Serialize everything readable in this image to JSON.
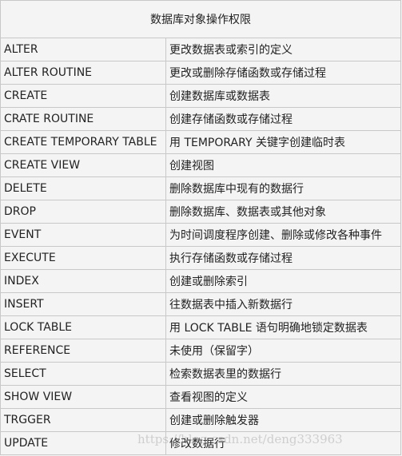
{
  "table": {
    "title": "数据库对象操作权限",
    "rows": [
      {
        "privilege": "ALTER",
        "description": "更改数据表或索引的定义"
      },
      {
        "privilege": "ALTER ROUTINE",
        "description": "更改或删除存储函数或存储过程"
      },
      {
        "privilege": "CREATE",
        "description": "创建数据库或数据表"
      },
      {
        "privilege": "CRATE ROUTINE",
        "description": "创建存储函数或存储过程"
      },
      {
        "privilege": "CREATE TEMPORARY TABLE",
        "description": "用 TEMPORARY 关键字创建临时表"
      },
      {
        "privilege": "CREATE VIEW",
        "description": "创建视图"
      },
      {
        "privilege": "DELETE",
        "description": "删除数据库中现有的数据行"
      },
      {
        "privilege": "DROP",
        "description": "删除数据库、数据表或其他对象"
      },
      {
        "privilege": "EVENT",
        "description": "为时间调度程序创建、删除或修改各种事件"
      },
      {
        "privilege": "EXECUTE",
        "description": "执行存储函数或存储过程"
      },
      {
        "privilege": "INDEX",
        "description": "创建或删除索引"
      },
      {
        "privilege": "INSERT",
        "description": "往数据表中插入新数据行"
      },
      {
        "privilege": "LOCK TABLE",
        "description": "用 LOCK TABLE 语句明确地锁定数据表"
      },
      {
        "privilege": "REFERENCE",
        "description": "未使用（保留字）"
      },
      {
        "privilege": "SELECT",
        "description": "检索数据表里的数据行"
      },
      {
        "privilege": "SHOW VIEW",
        "description": "查看视图的定义"
      },
      {
        "privilege": "TRGGER",
        "description": "创建或删除触发器"
      },
      {
        "privilege": "UPDATE",
        "description": "修改数据行"
      }
    ]
  },
  "watermark": "https://blog.csdn.net/deng333963"
}
